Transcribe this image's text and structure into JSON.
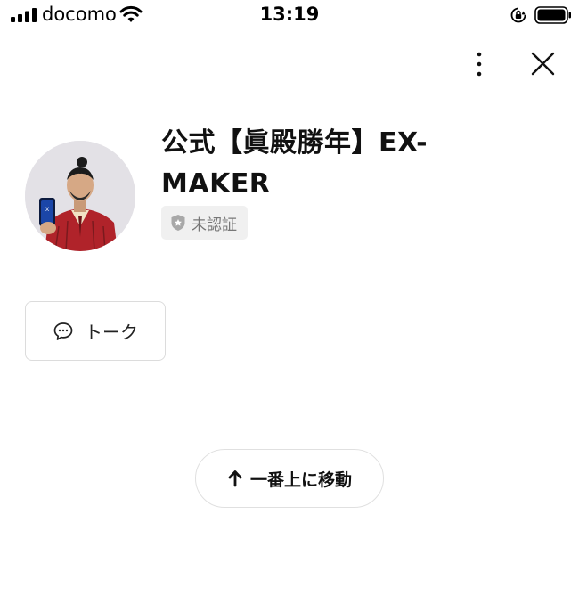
{
  "status_bar": {
    "carrier": "docomo",
    "time": "13:19",
    "icons": [
      "signal-icon",
      "wifi-icon",
      "orientation-lock-icon",
      "battery-icon"
    ]
  },
  "header": {
    "icons": [
      "more-vertical-icon",
      "close-icon"
    ]
  },
  "profile": {
    "name": "公式【眞殿勝年】EX-MAKER",
    "verification_badge": "未認証",
    "badge_icon": "shield-star-icon"
  },
  "actions": {
    "talk_label": "トーク",
    "talk_icon": "chat-bubble-icon"
  },
  "scroll_top": {
    "label": "一番上に移動",
    "icon": "arrow-up-icon"
  },
  "colors": {
    "background": "#ffffff",
    "text_primary": "#111111",
    "badge_bg": "#f0f0f0",
    "badge_text": "#777777",
    "border": "#dcdcdc",
    "avatar_suit": "#b0232a"
  }
}
